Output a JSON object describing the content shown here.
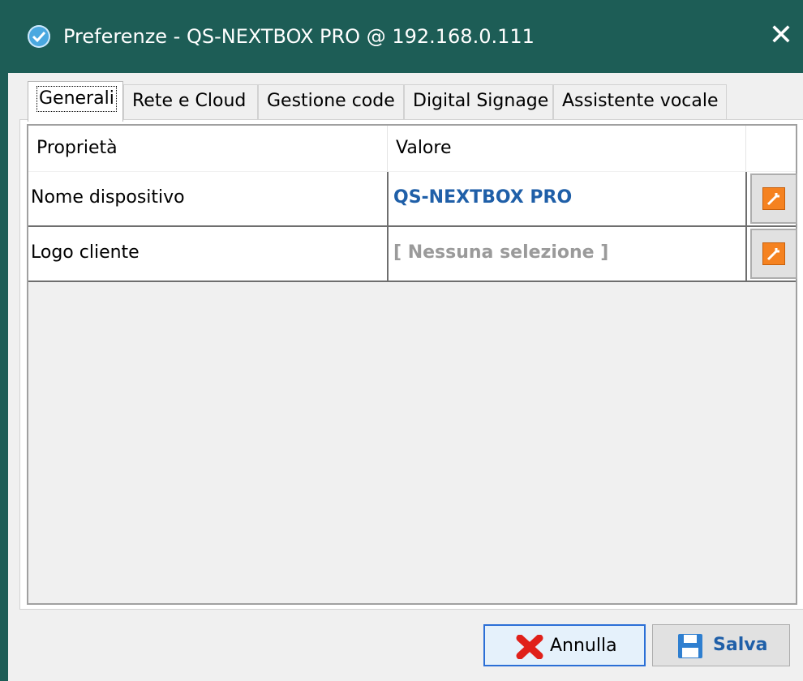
{
  "window": {
    "title": "Preferenze - QS-NEXTBOX PRO @ 192.168.0.111",
    "close_label": "✕",
    "accent_color": "#1d5d56"
  },
  "tabs": [
    {
      "label": "Generali",
      "active": true
    },
    {
      "label": "Rete e Cloud",
      "active": false
    },
    {
      "label": "Gestione code",
      "active": false
    },
    {
      "label": "Digital Signage",
      "active": false
    },
    {
      "label": "Assistente vocale",
      "active": false
    }
  ],
  "grid": {
    "columns": [
      "Proprietà",
      "Valore",
      ""
    ],
    "rows": [
      {
        "property": "Nome dispositivo",
        "value": "QS-NEXTBOX PRO",
        "value_color": "#1f5fa8",
        "action_icon": "wrench-icon"
      },
      {
        "property": "Logo cliente",
        "value": "[ Nessuna selezione ]",
        "value_color": "#9a9a9a",
        "action_icon": "wrench-icon"
      }
    ]
  },
  "buttons": {
    "cancel_label": "Annulla",
    "cancel_icon": "red-x-icon",
    "save_label": "Salva",
    "save_icon": "floppy-disk-icon"
  }
}
